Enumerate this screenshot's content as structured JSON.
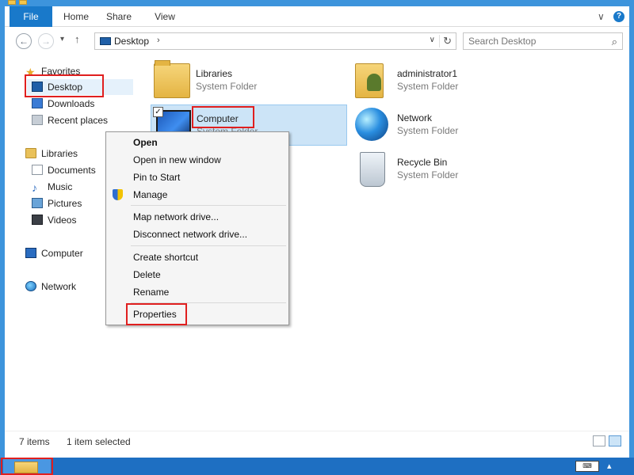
{
  "ribbon": {
    "tabs": [
      "File",
      "Home",
      "Share",
      "View"
    ],
    "expand_glyph": "∨",
    "help_glyph": "?"
  },
  "navigation": {
    "back_glyph": "←",
    "forward_glyph": "→",
    "recent_glyph": "▾",
    "up_glyph": "↑"
  },
  "address_bar": {
    "icon": "desktop-icon",
    "path": "Desktop",
    "chevron": "›",
    "dropdown_glyph": "∨",
    "refresh_glyph": "↻"
  },
  "search": {
    "placeholder": "Search Desktop",
    "value": "",
    "icon_glyph": "⌕"
  },
  "nav_pane": {
    "favorites": {
      "label": "Favorites",
      "items": [
        {
          "label": "Desktop",
          "icon": "desktop-icon",
          "selected": true
        },
        {
          "label": "Downloads",
          "icon": "downloads-icon"
        },
        {
          "label": "Recent places",
          "icon": "recent-places-icon"
        }
      ]
    },
    "libraries": {
      "label": "Libraries",
      "items": [
        {
          "label": "Documents",
          "icon": "documents-icon"
        },
        {
          "label": "Music",
          "icon": "music-icon"
        },
        {
          "label": "Pictures",
          "icon": "pictures-icon"
        },
        {
          "label": "Videos",
          "icon": "videos-icon"
        }
      ]
    },
    "computer": {
      "label": "Computer",
      "icon": "computer-icon"
    },
    "network": {
      "label": "Network",
      "icon": "network-icon"
    }
  },
  "content": {
    "items": [
      {
        "name": "Libraries",
        "type": "System Folder",
        "icon": "libraries-folder-icon"
      },
      {
        "name": "administrator1",
        "type": "System Folder",
        "icon": "user-folder-icon"
      },
      {
        "name": "Computer",
        "type": "System Folder",
        "icon": "computer-icon",
        "selected": true,
        "checked": true
      },
      {
        "name": "Network",
        "type": "System Folder",
        "icon": "network-globe-icon"
      },
      {
        "name": "Recycle Bin",
        "type": "System Folder",
        "icon": "recycle-bin-icon"
      }
    ]
  },
  "context_menu": {
    "items": [
      {
        "label": "Open",
        "bold": true
      },
      {
        "label": "Open in new window"
      },
      {
        "label": "Pin to Start"
      },
      {
        "label": "Manage",
        "icon": "shield-icon"
      },
      {
        "label": "Map network drive..."
      },
      {
        "label": "Disconnect network drive..."
      },
      {
        "label": "Create shortcut"
      },
      {
        "label": "Delete"
      },
      {
        "label": "Rename"
      },
      {
        "label": "Properties",
        "highlighted": true
      }
    ]
  },
  "status_bar": {
    "items_count": "7 items",
    "selection": "1 item selected"
  },
  "taskbar": {
    "keyboard_label": "⌨",
    "tray_glyph": "▴"
  },
  "colors": {
    "accent": "#1979ca",
    "highlight_box": "#e01f1f",
    "selection": "#cce4f7"
  }
}
